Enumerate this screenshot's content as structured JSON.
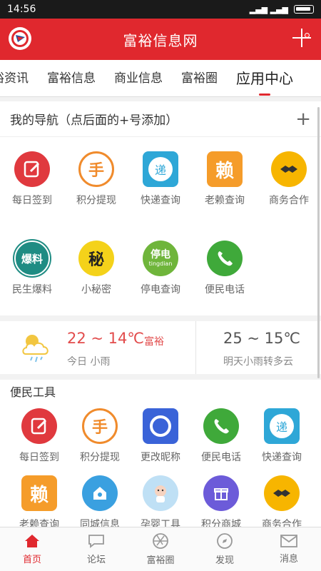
{
  "status_bar": {
    "time": "14:56"
  },
  "header": {
    "title": "富裕信息网"
  },
  "tabs": [
    {
      "label": "裕资讯"
    },
    {
      "label": "富裕信息"
    },
    {
      "label": "商业信息"
    },
    {
      "label": "富裕圈"
    },
    {
      "label": "应用中心",
      "active": true
    }
  ],
  "nav_section": {
    "title": "我的导航（点后面的+号添加）",
    "add_label": "+",
    "items": [
      {
        "label": "每日签到",
        "icon": "edit-icon",
        "color": "#e0393e"
      },
      {
        "label": "积分提现",
        "icon": "points-icon",
        "color": "#f08b2c"
      },
      {
        "label": "快递查询",
        "icon": "express-icon",
        "color": "#2ea7d7"
      },
      {
        "label": "老赖查询",
        "icon": "debtor-icon",
        "color": "#f59c2a"
      },
      {
        "label": "商务合作",
        "icon": "handshake-icon",
        "color": "#f7b500"
      },
      {
        "label": "民生爆料",
        "icon": "report-icon",
        "color": "#1f8c83",
        "text": "爆料"
      },
      {
        "label": "小秘密",
        "icon": "secret-icon",
        "color": "#f4d21a",
        "text": "秘"
      },
      {
        "label": "停电查询",
        "icon": "power-icon",
        "color": "#6fb53b",
        "text": "停电",
        "sub": "tingdian"
      },
      {
        "label": "便民电话",
        "icon": "phone-icon",
        "color": "#3fa93a"
      }
    ]
  },
  "weather": {
    "today_temp": "22 ~ 14℃",
    "city": "富裕",
    "today_desc": "今日 小雨",
    "tomorrow_temp": "25 ~ 15℃",
    "tomorrow_desc": "明天小雨转多云"
  },
  "tools_section": {
    "title": "便民工具",
    "items": [
      {
        "label": "每日签到",
        "icon": "edit-icon",
        "color": "#e0393e"
      },
      {
        "label": "积分提现",
        "icon": "points-icon",
        "color": "#f08b2c"
      },
      {
        "label": "更改昵称",
        "icon": "rename-icon",
        "color": "#3a63d8"
      },
      {
        "label": "便民电话",
        "icon": "phone-icon",
        "color": "#3fa93a"
      },
      {
        "label": "快递查询",
        "icon": "express-icon",
        "color": "#2ea7d7"
      },
      {
        "label": "老赖查询",
        "icon": "debtor-icon",
        "color": "#f59c2a"
      },
      {
        "label": "同城信息",
        "icon": "location-icon",
        "color": "#3aa0e0"
      },
      {
        "label": "孕婴工具",
        "icon": "baby-icon",
        "color": "#bfe0f5"
      },
      {
        "label": "积分商城",
        "icon": "gift-icon",
        "color": "#6c5bd9"
      },
      {
        "label": "商务合作",
        "icon": "handshake-icon",
        "color": "#f7b500"
      }
    ]
  },
  "bottom_nav": [
    {
      "label": "首页",
      "icon": "home-icon",
      "active": true
    },
    {
      "label": "论坛",
      "icon": "chat-icon"
    },
    {
      "label": "富裕圈",
      "icon": "aperture-icon"
    },
    {
      "label": "发现",
      "icon": "compass-icon"
    },
    {
      "label": "消息",
      "icon": "mail-icon"
    }
  ]
}
